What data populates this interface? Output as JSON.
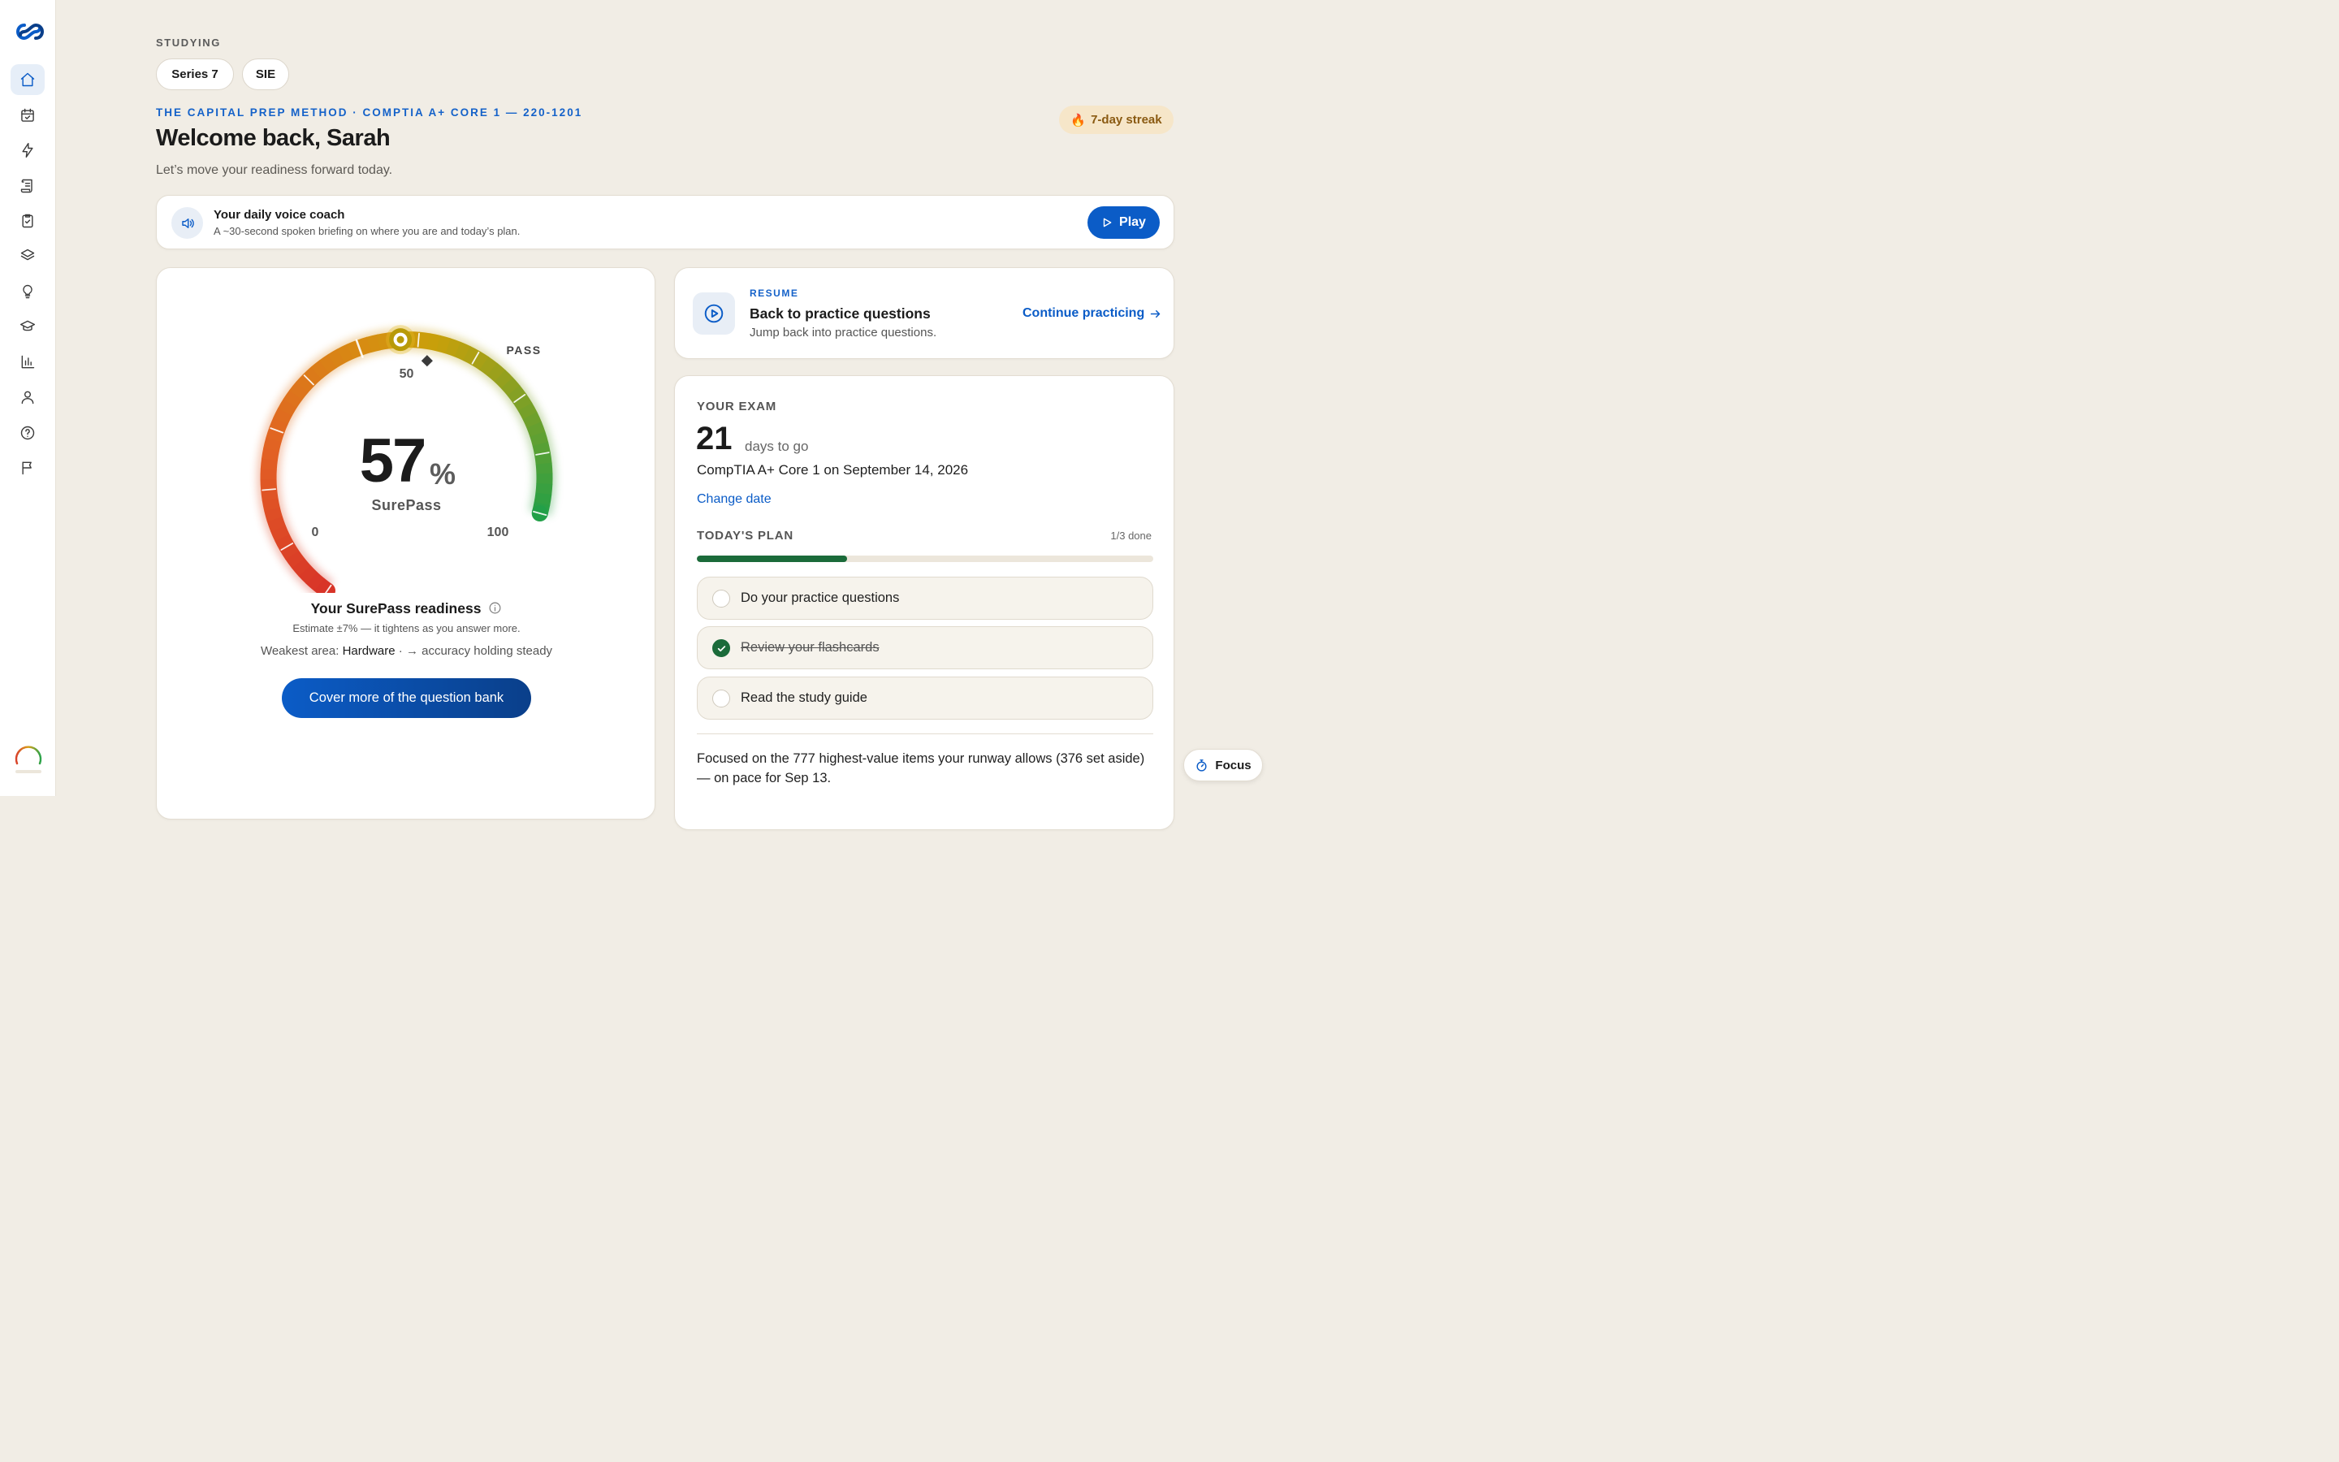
{
  "header": {
    "studying_label": "STUDYING",
    "chips": [
      "Series 7",
      "SIE"
    ],
    "method_label": "THE CAPITAL PREP METHOD · COMPTIA A+ CORE 1 — 220-1201",
    "welcome": "Welcome back, Sarah",
    "subtitle": "Let’s move your readiness forward today.",
    "streak": "7-day streak",
    "streak_icon": "flame-icon"
  },
  "coach": {
    "title": "Your daily voice coach",
    "subtitle": "A ~30-second spoken briefing on where you are and today’s plan.",
    "play_label": "Play"
  },
  "gauge": {
    "value": 57,
    "value_text": "57",
    "unit": "%",
    "name": "SurePass",
    "pass_label": "PASS",
    "pass_mark": 62,
    "min_label": "0",
    "mid_label": "50",
    "max_label": "100",
    "readiness_title": "Your SurePass readiness",
    "estimate": "Estimate ±7% — it tightens as you answer more.",
    "weakest_prefix": "Weakest area:",
    "weakest_area": "Hardware",
    "weakest_trend": "· → accuracy holding steady",
    "cover_button": "Cover more of the question bank"
  },
  "resume": {
    "label": "RESUME",
    "title": "Back to practice questions",
    "subtitle": "Jump back into practice questions.",
    "continue_label": "Continue practicing"
  },
  "exam": {
    "label": "YOUR EXAM",
    "days": "21",
    "days_text": "days to go",
    "exam_date": "CompTIA A+ Core 1 on September 14, 2026",
    "change_date": "Change date"
  },
  "plan": {
    "label": "TODAY'S PLAN",
    "done_text": "1/3 done",
    "progress_fraction": 0.33,
    "tasks": [
      {
        "label": "Do your practice questions",
        "done": false
      },
      {
        "label": "Review your flashcards",
        "done": true
      },
      {
        "label": "Read the study guide",
        "done": false
      }
    ],
    "focus_text": "Focused on the 777 highest-value items your runway allows (376 set aside) — on pace for Sep 13."
  },
  "focus_button": "Focus",
  "colors": {
    "accent": "#0b5cc7",
    "success": "#1b6b3a",
    "background": "#f1ede5"
  },
  "sidebar_icons": [
    "home-icon",
    "calendar-check-icon",
    "lightning-icon",
    "scroll-icon",
    "clipboard-check-icon",
    "layers-icon",
    "lightbulb-icon",
    "graduation-cap-icon",
    "bar-chart-icon",
    "user-icon",
    "help-circle-icon",
    "flag-icon"
  ]
}
